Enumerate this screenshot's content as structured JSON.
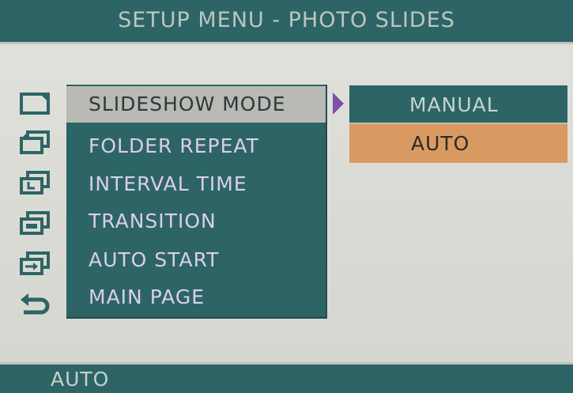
{
  "header": {
    "title": "SETUP MENU - PHOTO SLIDES"
  },
  "menu": {
    "items": [
      {
        "label": "SLIDESHOW MODE",
        "icon": "slideshow-mode-icon",
        "selected": true
      },
      {
        "label": "FOLDER REPEAT",
        "icon": "folder-repeat-icon",
        "selected": false
      },
      {
        "label": "INTERVAL TIME",
        "icon": "interval-time-icon",
        "selected": false
      },
      {
        "label": "TRANSITION",
        "icon": "transition-icon",
        "selected": false
      },
      {
        "label": "AUTO START",
        "icon": "auto-start-icon",
        "selected": false
      },
      {
        "label": "MAIN PAGE",
        "icon": "return-icon",
        "selected": false
      }
    ]
  },
  "submenu": {
    "options": [
      {
        "label": "MANUAL",
        "highlighted": false
      },
      {
        "label": "AUTO",
        "highlighted": true
      }
    ]
  },
  "status": {
    "text": "AUTO"
  },
  "colors": {
    "panel": "#2d6566",
    "selection": "#b9bab4",
    "highlight": "#d99a62",
    "arrow": "#7c4fa8",
    "background": "#dcdcd6"
  }
}
